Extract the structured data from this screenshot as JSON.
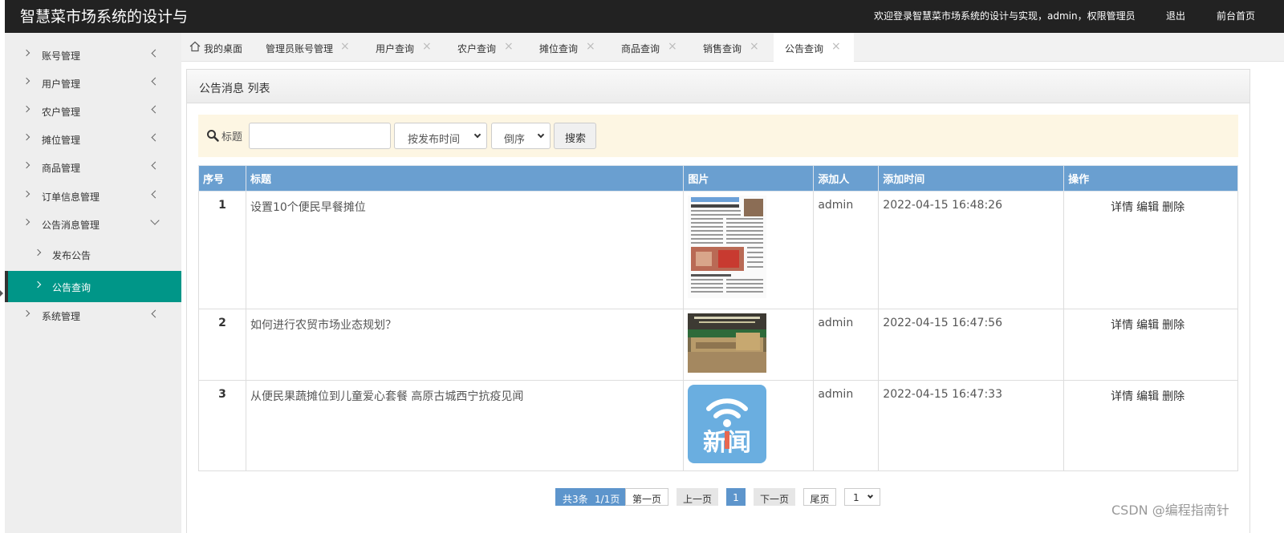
{
  "header": {
    "brand": "智慧菜市场系统的设计与",
    "welcome": "欢迎登录智慧菜市场系统的设计与实现，admin，权限管理员",
    "logout": "退出",
    "home": "前台首页"
  },
  "sidebar": {
    "items": [
      {
        "label": "账号管理"
      },
      {
        "label": "用户管理"
      },
      {
        "label": "农户管理"
      },
      {
        "label": "摊位管理"
      },
      {
        "label": "商品管理"
      },
      {
        "label": "订单信息管理"
      },
      {
        "label": "公告消息管理"
      },
      {
        "label": "发布公告"
      },
      {
        "label": "公告查询"
      },
      {
        "label": "系统管理"
      }
    ]
  },
  "tabs": [
    {
      "label": "我的桌面"
    },
    {
      "label": "管理员账号管理"
    },
    {
      "label": "用户查询"
    },
    {
      "label": "农户查询"
    },
    {
      "label": "摊位查询"
    },
    {
      "label": "商品查询"
    },
    {
      "label": "销售查询"
    },
    {
      "label": "公告查询"
    }
  ],
  "panel": {
    "title": "公告消息 列表"
  },
  "search": {
    "label": "标题",
    "value": "",
    "sort_field": "按发布时间",
    "sort_order": "倒序",
    "button": "搜索"
  },
  "table": {
    "headers": [
      "序号",
      "标题",
      "图片",
      "添加人",
      "添加时间",
      "操作"
    ],
    "rows": [
      {
        "num": "1",
        "title": "设置10个便民早餐摊位",
        "adder": "admin",
        "time": "2022-04-15 16:48:26",
        "op_detail": "详情",
        "op_edit": "编辑",
        "op_delete": "删除"
      },
      {
        "num": "2",
        "title": "如何进行农贸市场业态规划？",
        "adder": "admin",
        "time": "2022-04-15 16:47:56",
        "op_detail": "详情",
        "op_edit": "编辑",
        "op_delete": "删除"
      },
      {
        "num": "3",
        "title": "从便民果蔬摊位到儿童爱心套餐 高原古城西宁抗疫见闻",
        "adder": "admin",
        "time": "2022-04-15 16:47:33",
        "op_detail": "详情",
        "op_edit": "编辑",
        "op_delete": "删除"
      }
    ],
    "news_logo_text": "新闻"
  },
  "pagination": {
    "info_count": "共3条",
    "info_pages": "1/1页",
    "first": "第一页",
    "prev": "上一页",
    "current": "1",
    "next": "下一页",
    "last": "尾页",
    "select_value": "1"
  },
  "watermark": "CSDN @编程指南针",
  "colors": {
    "topbar": "#222222",
    "sidebar": "#eeeeee",
    "active": "#009688",
    "table_header": "#6a9fd0",
    "search_bg": "#fdf6e3"
  }
}
